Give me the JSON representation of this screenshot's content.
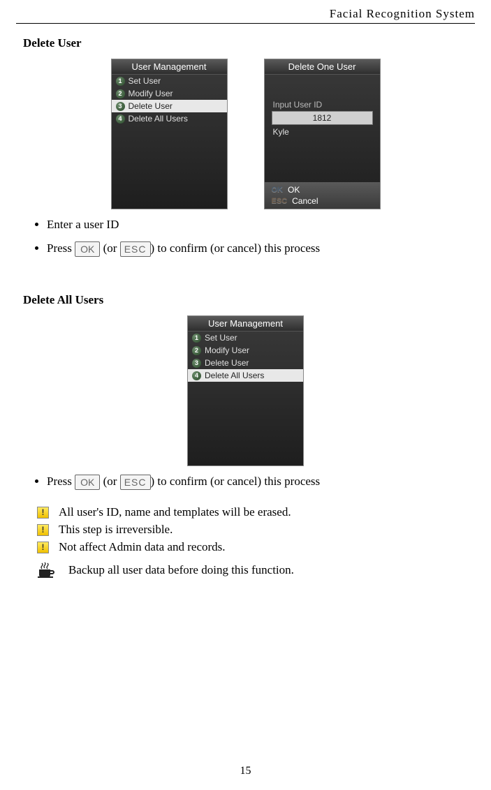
{
  "header": "Facial  Recognition  System",
  "page_number": "15",
  "s1": {
    "title": "Delete User",
    "um_title": "User Management",
    "items": [
      "Set User",
      "Modify User",
      "Delete User",
      "Delete All Users"
    ],
    "sel_idx": 2,
    "del_title": "Delete One User",
    "input_label": "Input User ID",
    "input_value": "1812",
    "name_value": "Kyle",
    "ok_key": "OK",
    "ok_label": "OK",
    "esc_key": "ESC",
    "esc_label": "Cancel",
    "bullet1": "Enter a user ID",
    "b2_pre": "Press ",
    "b2_ok": "OK",
    "b2_mid": " (or ",
    "b2_esc": "ESC",
    "b2_post": ") to confirm (or cancel) this process"
  },
  "s2": {
    "title": "Delete All Users",
    "um_title": "User Management",
    "items": [
      "Set User",
      "Modify User",
      "Delete User",
      "Delete All Users"
    ],
    "sel_idx": 3,
    "b1_pre": "Press ",
    "b1_ok": "OK",
    "b1_mid": " (or ",
    "b1_esc": "ESC",
    "b1_post": ") to confirm (or cancel) this process",
    "note1": "All user's ID, name and templates will be erased.",
    "note2": "This step is irreversible.",
    "note3": "Not affect Admin data and records.",
    "note4": "Backup all user data before doing this function."
  }
}
